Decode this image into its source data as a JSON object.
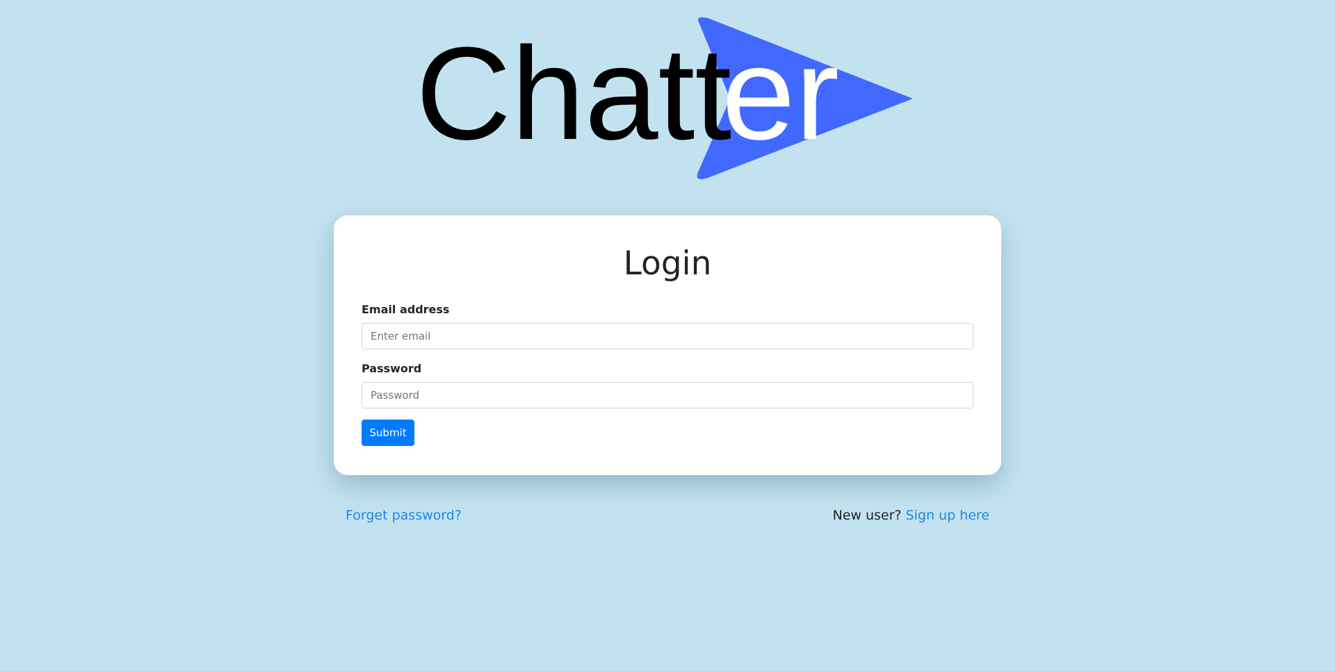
{
  "brand": {
    "logo_text_dark": "Chatt",
    "logo_text_light": "er",
    "arrow_color": "#4169ff"
  },
  "login": {
    "title": "Login",
    "email_label": "Email address",
    "email_placeholder": "Enter email",
    "email_value": "",
    "password_label": "Password",
    "password_placeholder": "Password",
    "password_value": "",
    "submit_label": "Submit"
  },
  "footer": {
    "forgot_password_link": "Forget password?",
    "new_user_text": "New user? ",
    "signup_link": "Sign up here"
  },
  "colors": {
    "background": "#c3e2f0",
    "primary_button": "#007bff",
    "link": "#1d87e4"
  }
}
